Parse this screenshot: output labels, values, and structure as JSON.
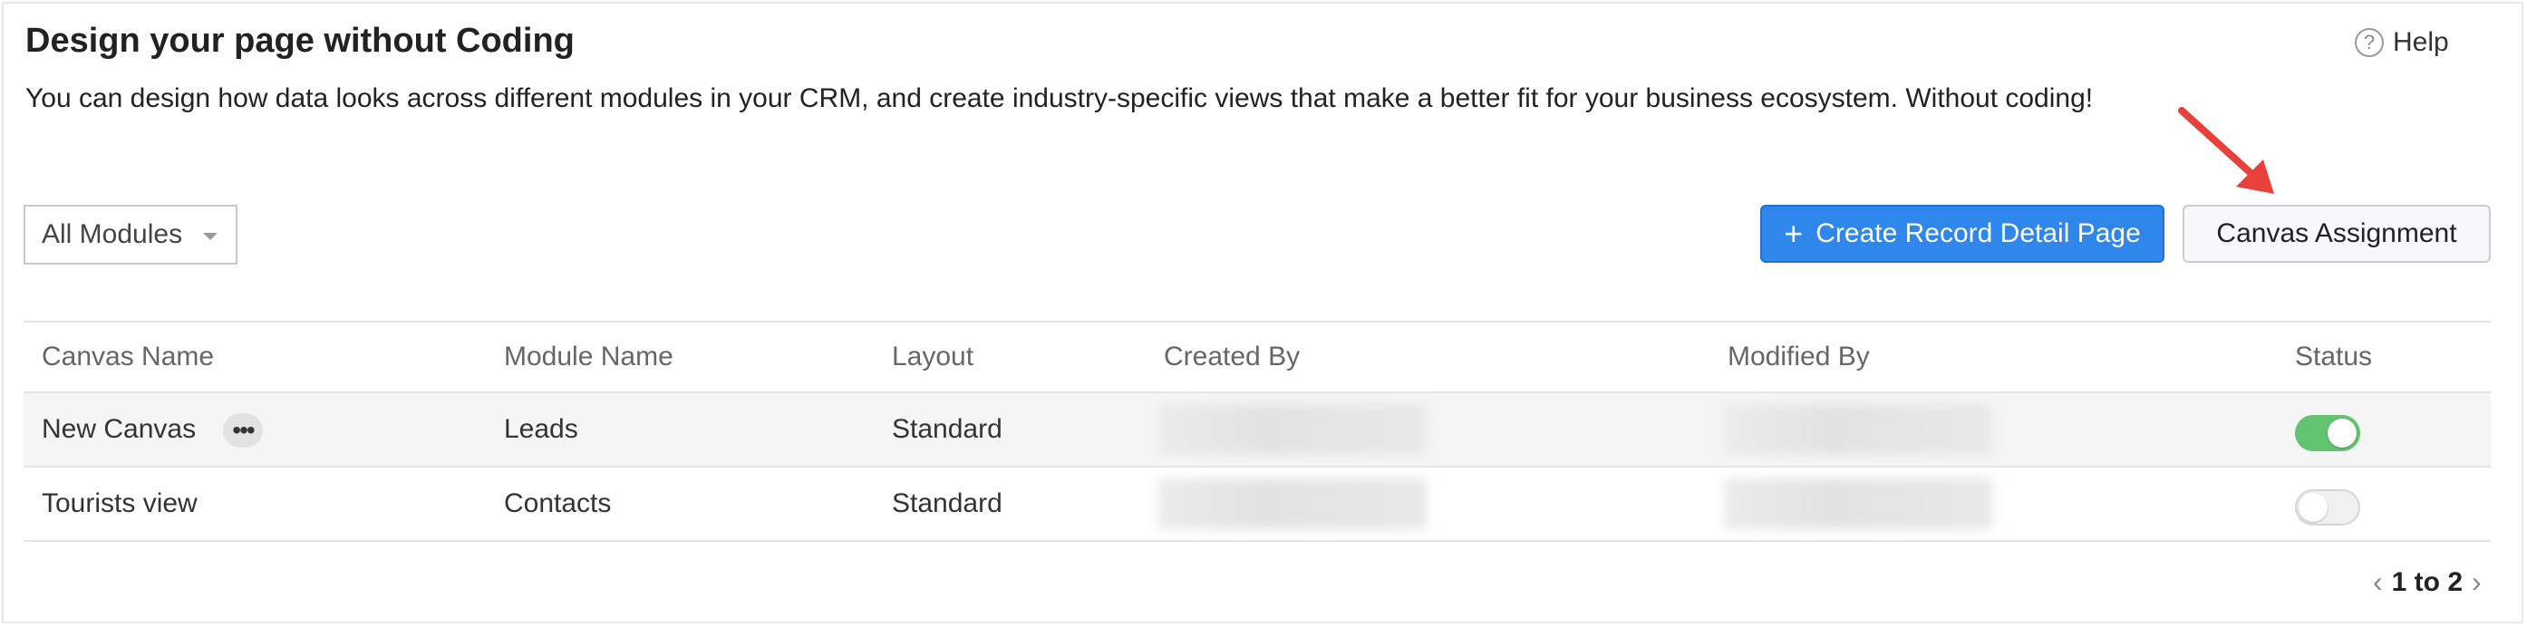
{
  "header": {
    "title": "Design your page without Coding",
    "description": "You can design how data looks across different modules in your CRM, and create industry-specific views that make a better fit for your business ecosystem. Without coding!",
    "help_label": "Help",
    "help_icon": "question-circle-icon"
  },
  "toolbar": {
    "module_filter": "All Modules",
    "create_button": "Create Record Detail Page",
    "assignment_button": "Canvas Assignment",
    "accent_color": "#2f86eb"
  },
  "table": {
    "columns": [
      "Canvas Name",
      "Module Name",
      "Layout",
      "Created By",
      "Modified By",
      "Status"
    ],
    "rows": [
      {
        "canvas_name": "New Canvas",
        "module_name": "Leads",
        "layout": "Standard",
        "status": "on"
      },
      {
        "canvas_name": "Tourists view",
        "module_name": "Contacts",
        "layout": "Standard",
        "status": "off"
      }
    ]
  },
  "pagination": {
    "label": "1 to 2"
  },
  "colors": {
    "toggle_on": "#62c370",
    "annotation_arrow": "#e8403a"
  }
}
